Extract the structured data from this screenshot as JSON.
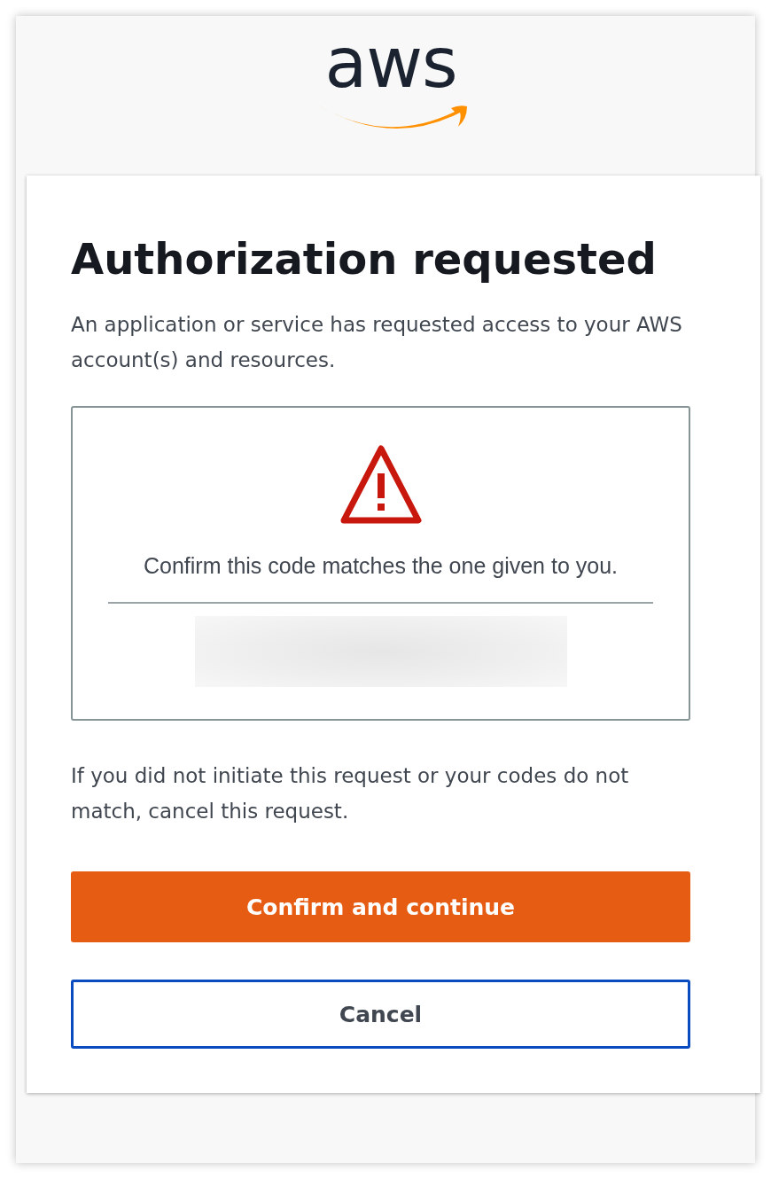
{
  "logo": {
    "text": "aws"
  },
  "card": {
    "title": "Authorization requested",
    "intro": "An application or service has requested access to your AWS account(s) and resources.",
    "code_box": {
      "message": "Confirm this code matches the one given to you."
    },
    "note": "If you did not initiate this request or your codes do not match, cancel this request.",
    "buttons": [
      {
        "label": "Confirm and continue",
        "kind": "primary"
      },
      {
        "label": "Cancel",
        "kind": "secondary"
      }
    ]
  }
}
